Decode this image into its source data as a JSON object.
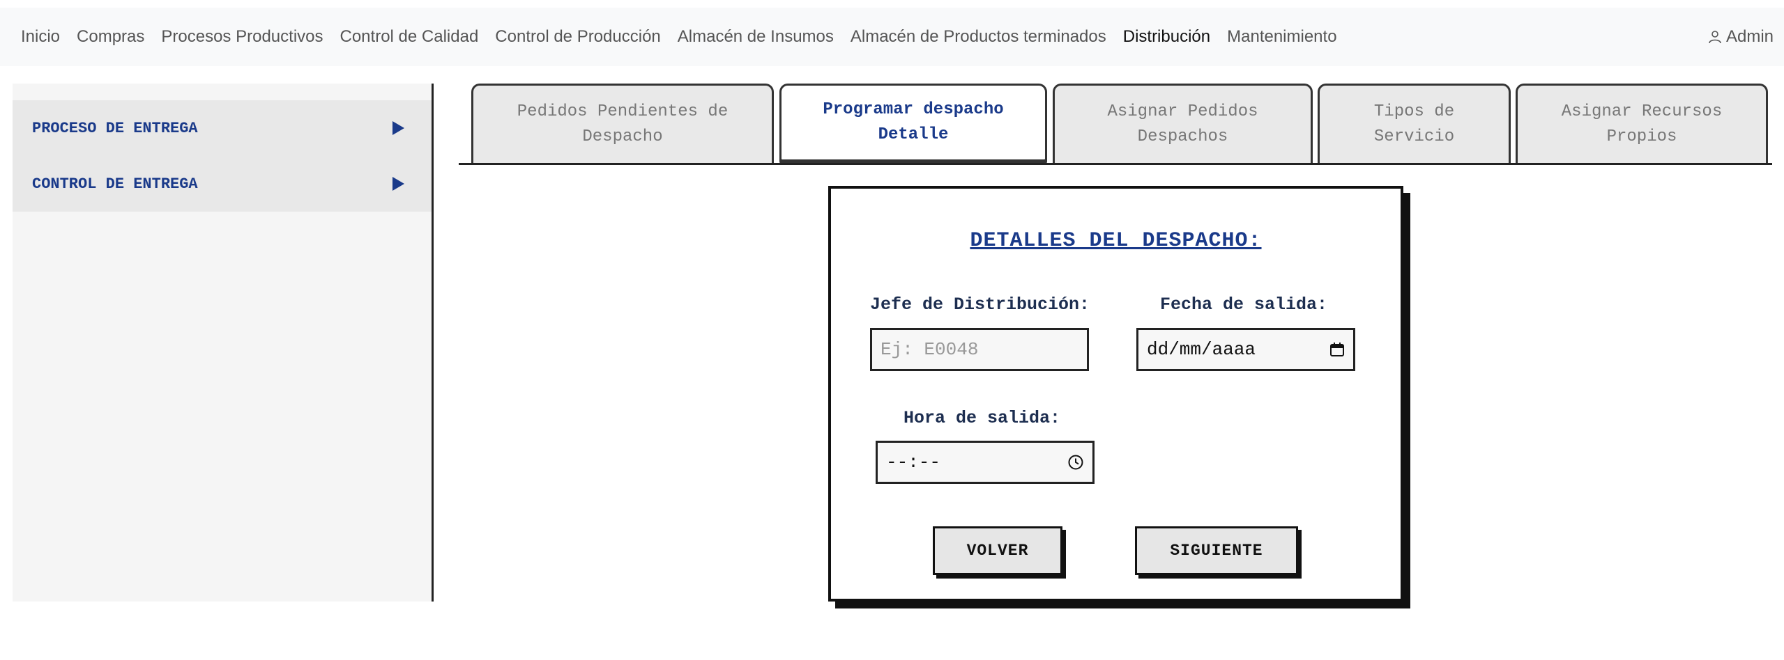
{
  "navbar": {
    "links": [
      {
        "label": "Inicio",
        "active": false
      },
      {
        "label": "Compras",
        "active": false
      },
      {
        "label": "Procesos Productivos",
        "active": false
      },
      {
        "label": "Control de Calidad",
        "active": false
      },
      {
        "label": "Control de Producción",
        "active": false
      },
      {
        "label": "Almacén de Insumos",
        "active": false
      },
      {
        "label": "Almacén de Productos terminados",
        "active": false
      },
      {
        "label": "Distribución",
        "active": true
      },
      {
        "label": "Mantenimiento",
        "active": false
      }
    ],
    "user_label": "Admin",
    "user_icon": "user-icon"
  },
  "sidebar": {
    "items": [
      {
        "label": "PROCESO DE ENTREGA",
        "icon": "triangle-right-icon"
      },
      {
        "label": "CONTROL DE ENTREGA",
        "icon": "triangle-right-icon"
      }
    ]
  },
  "tabs": [
    {
      "line1": "Pedidos Pendientes de",
      "line2": "Despacho",
      "active": false
    },
    {
      "line1": "Programar despacho",
      "line2": "Detalle",
      "active": true
    },
    {
      "line1": "Asignar Pedidos",
      "line2": "Despachos",
      "active": false
    },
    {
      "line1": "Tipos de",
      "line2": "Servicio",
      "active": false
    },
    {
      "line1": "Asignar Recursos",
      "line2": "Propios",
      "active": false
    }
  ],
  "form": {
    "title": "DETALLES DEL DESPACHO:",
    "jefe_label": "Jefe de Distribución:",
    "jefe_placeholder": "Ej: E0048",
    "jefe_value": "",
    "fecha_label": "Fecha de salida:",
    "fecha_value": "dd/mm/aaaa",
    "fecha_icon": "calendar-icon",
    "hora_label": "Hora de salida:",
    "hora_value": "--:--",
    "hora_icon": "clock-icon",
    "back_label": "VOLVER",
    "next_label": "SIGUIENTE"
  },
  "colors": {
    "accent": "#1a3a8a",
    "navbar_bg": "#f8f9fa",
    "tab_bg": "#e9e9e9"
  }
}
